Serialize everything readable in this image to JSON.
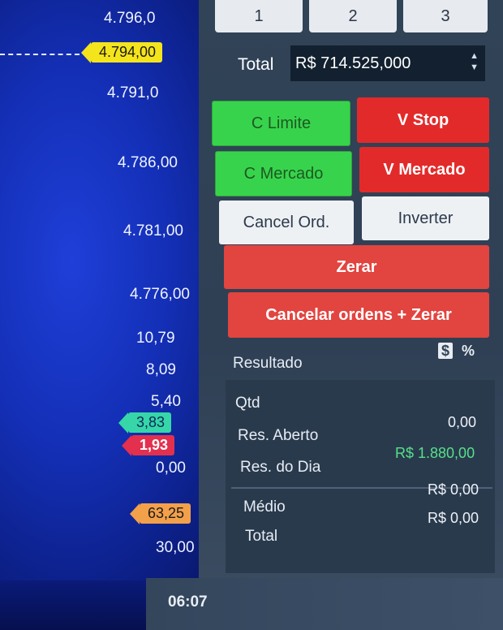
{
  "chart": {
    "prices": [
      "4.796,0",
      "4.791,0",
      "4.786,00",
      "4.781,00",
      "4.776,00",
      "10,79",
      "8,09",
      "5,40",
      "0,00",
      "30,00"
    ],
    "tags": {
      "current_price": "4.794,00",
      "green": "3,83",
      "red": "1,93",
      "orange": "63,25"
    },
    "time": "06:07"
  },
  "tabs": [
    "1",
    "2",
    "3"
  ],
  "order": {
    "total_label": "Total",
    "total_value": "R$ 714.525,000",
    "spin_up": "▲",
    "spin_down": "▼"
  },
  "buttons": {
    "buy_limit": "C Limite",
    "sell_stop": "V Stop",
    "buy_market": "C Mercado",
    "sell_market": "V Mercado",
    "cancel_orders": "Cancel Ord.",
    "invert": "Inverter",
    "zero": "Zerar",
    "cancel_and_zero": "Cancelar ordens + Zerar"
  },
  "result": {
    "label": "Resultado",
    "toggle_currency": "$",
    "toggle_percent": "%",
    "qty_label": "Qtd",
    "open_label": "Res. Aberto",
    "open_value": "0,00",
    "day_label": "Res. do Dia",
    "day_value": "R$ 1.880,00",
    "avg_label": "Médio",
    "avg_value": "R$ 0,00",
    "total_label": "Total",
    "total_value": "R$ 0,00"
  },
  "colors": {
    "buy": "#38d34c",
    "sell": "#e32a2a",
    "positive": "#55e08a"
  }
}
